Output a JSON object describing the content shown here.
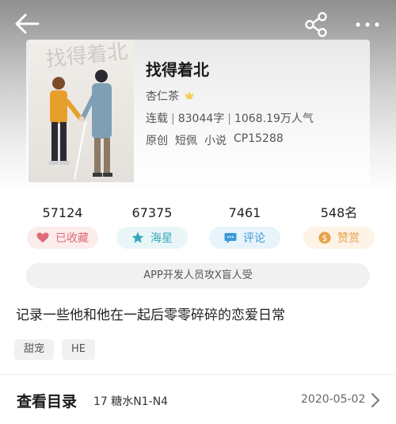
{
  "book": {
    "title": "找得着北",
    "author": "杏仁茶",
    "status": "连载",
    "word_count": "83044字",
    "popularity": "1068.19万人气",
    "tags": [
      "原创",
      "短佩",
      "小说",
      "CP15288"
    ],
    "cover_text": "找得着北"
  },
  "metrics": [
    {
      "value": "57124",
      "label": "已收藏",
      "icon": "heart-icon",
      "color": "#e06a78"
    },
    {
      "value": "67375",
      "label": "海星",
      "icon": "star-icon",
      "color": "#3aa7b8"
    },
    {
      "value": "7461",
      "label": "评论",
      "icon": "comment-icon",
      "color": "#3d9ad6"
    },
    {
      "value": "548名",
      "label": "赞赏",
      "icon": "coin-icon",
      "color": "#e6a34a"
    }
  ],
  "cp_banner": "APP开发人员攻X盲人受",
  "summary": "记录一些他和他在一起后零零碎碎的恋爱日常",
  "chips": [
    "甜宠",
    "HE"
  ],
  "toc": {
    "label": "查看目录",
    "latest_chapter": "17 糖水N1-N4",
    "date": "2020-05-02"
  },
  "icons": {
    "back": "back-arrow-icon",
    "share": "share-icon",
    "more": "more-dots-icon",
    "author_badge": "crown-badge-icon",
    "toc_arrow": "chevron-right-icon"
  }
}
